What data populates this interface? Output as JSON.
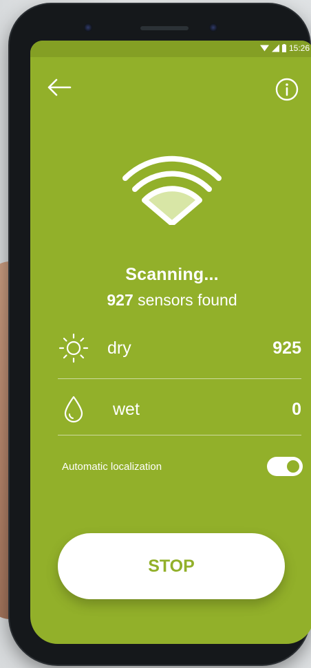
{
  "status_bar": {
    "time": "15:26",
    "icons": [
      "wifi-icon",
      "signal-icon",
      "battery-icon"
    ]
  },
  "header": {
    "back_icon": "arrow-left-icon",
    "info_icon": "info-icon"
  },
  "scan": {
    "icon": "wifi-scan-icon",
    "title": "Scanning...",
    "count": "927",
    "count_suffix": "sensors found"
  },
  "results": [
    {
      "icon": "sun-icon",
      "label": "dry",
      "value": "925"
    },
    {
      "icon": "droplet-icon",
      "label": "wet",
      "value": "0"
    }
  ],
  "auto_localization": {
    "label": "Automatic localization",
    "enabled": true
  },
  "actions": {
    "stop_label": "STOP"
  },
  "colors": {
    "primary": "#92b02a",
    "status_bar": "#849f24",
    "foreground": "#ffffff",
    "wifi_fill": "#d8e6a6"
  }
}
